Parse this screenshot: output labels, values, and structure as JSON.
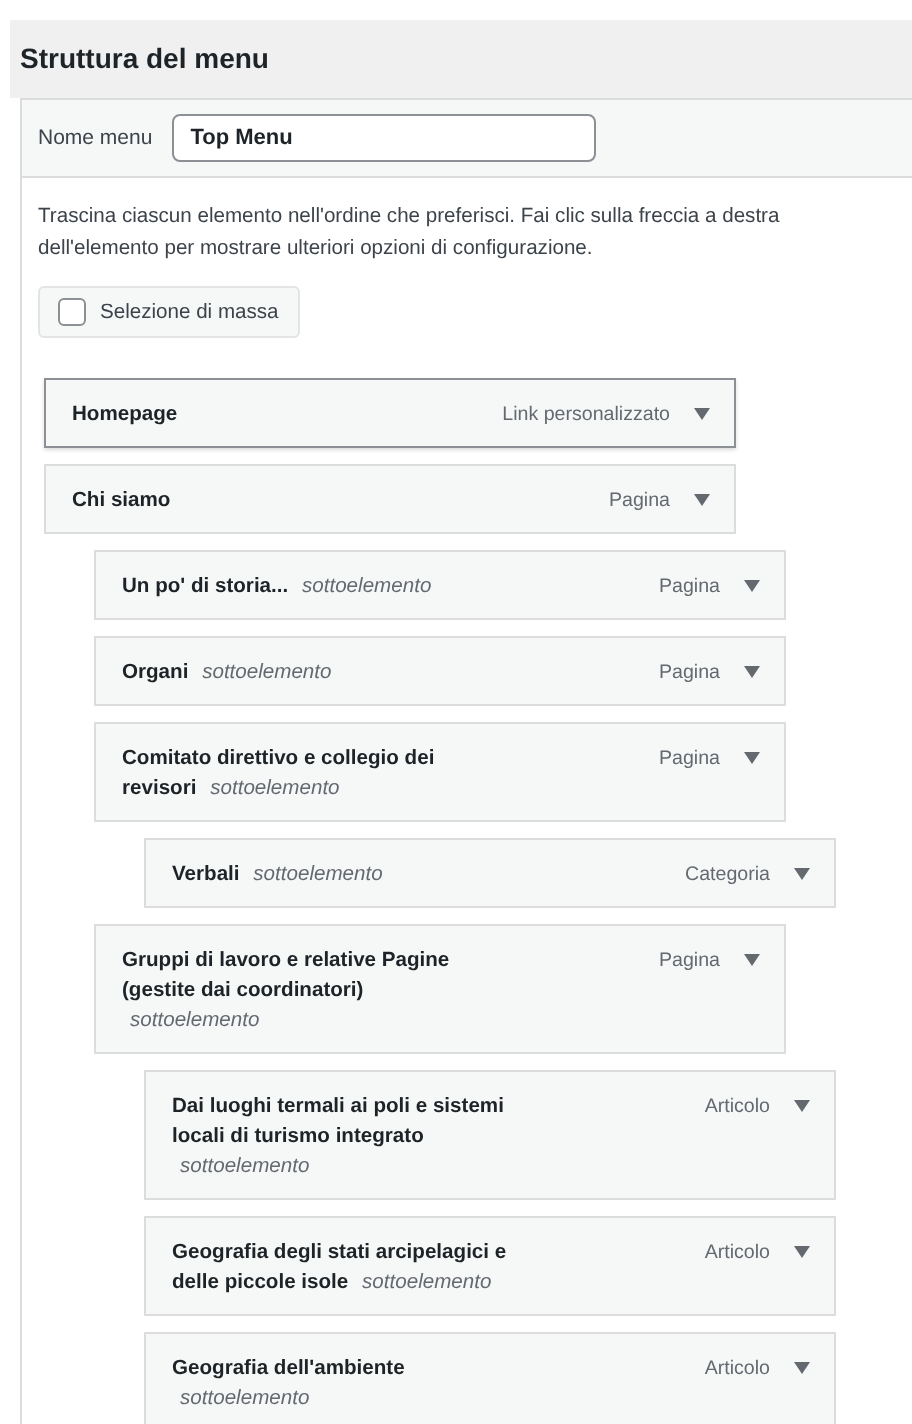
{
  "header": {
    "title": "Struttura del menu"
  },
  "menu_name": {
    "label": "Nome menu",
    "value": "Top Menu"
  },
  "instructions": "Trascina ciascun elemento nell'ordine che preferisci. Fai clic sulla freccia a destra dell'elemento per mostrare ulteriori opzioni di configurazione.",
  "bulk_select": {
    "label": "Selezione di massa",
    "checked": false
  },
  "items": [
    {
      "title": "Homepage",
      "type": "Link personalizzato",
      "selected": true
    },
    {
      "title": "Chi siamo",
      "type": "Pagina",
      "selected": false,
      "children": [
        {
          "title": "Un po' di storia...",
          "sublabel": "sottoelemento",
          "type": "Pagina",
          "selected": false
        },
        {
          "title": "Organi",
          "sublabel": "sottoelemento",
          "type": "Pagina",
          "selected": false
        },
        {
          "title": "Comitato direttivo e collegio dei revisori",
          "sublabel": "sottoelemento",
          "type": "Pagina",
          "selected": false,
          "children": [
            {
              "title": "Verbali",
              "sublabel": "sottoelemento",
              "type": "Categoria",
              "selected": false
            }
          ]
        },
        {
          "title": "Gruppi di lavoro e relative Pagine (gestite dai coordinatori)",
          "sublabel": "sottoelemento",
          "type": "Pagina",
          "selected": false,
          "children": [
            {
              "title": "Dai luoghi termali ai poli e sistemi locali di turismo integrato",
              "sublabel": "sottoelemento",
              "type": "Articolo",
              "selected": false
            },
            {
              "title": "Geografia degli stati arcipelagici e delle piccole isole",
              "sublabel": "sottoelemento",
              "type": "Articolo",
              "selected": false
            },
            {
              "title": "Geografia dell'ambiente",
              "sublabel": "sottoelemento",
              "type": "Articolo",
              "selected": false
            }
          ]
        }
      ]
    }
  ]
}
